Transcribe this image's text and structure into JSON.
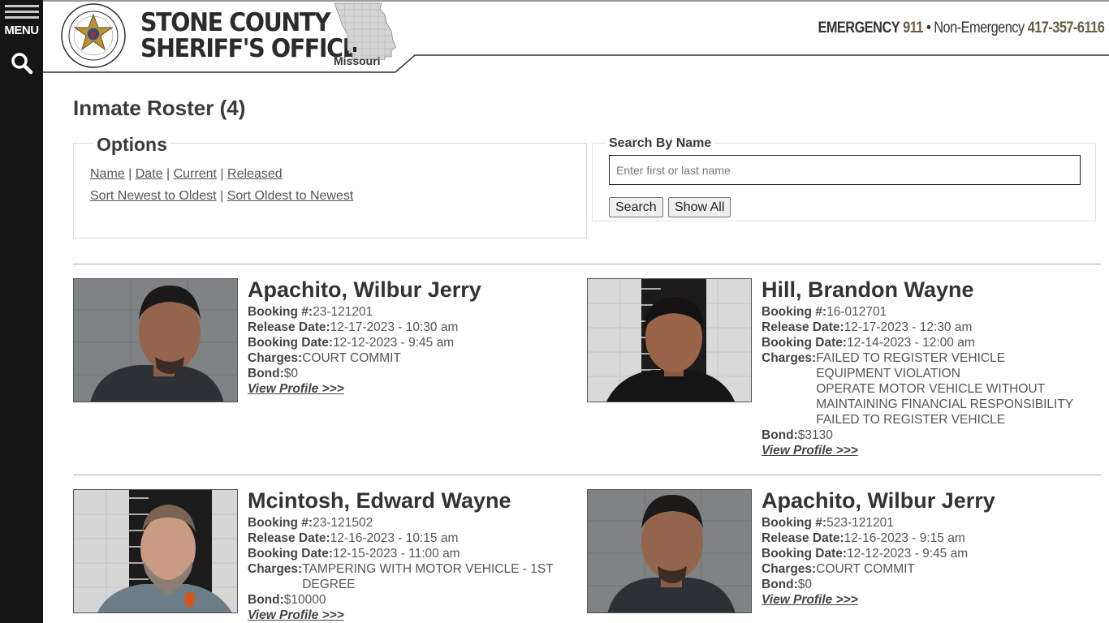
{
  "nav": {
    "menu_label": "MENU"
  },
  "header": {
    "org_line1": "STONE COUNTY",
    "org_line2": "SHERIFF'S OFFICE",
    "state_label": "Missouri",
    "seal_text_top": "STONE COUNTY SHERIFF'S OFFICE",
    "seal_text_center": "SHERIFF",
    "seal_text_bottom": "EST. 1851",
    "emergency_label": "EMERGENCY",
    "emergency_number": "911",
    "separator": "•",
    "nonemergency_label": "Non-Emergency",
    "nonemergency_number": "417-357-6116"
  },
  "page": {
    "title": "Inmate Roster (4)"
  },
  "options": {
    "legend": "Options",
    "sort_links": [
      "Name",
      "Date",
      "Current",
      "Released"
    ],
    "order_links": [
      "Sort Newest to Oldest",
      "Sort Oldest to Newest"
    ],
    "separator": "|"
  },
  "search": {
    "legend": "Search By Name",
    "placeholder": "Enter first or last name",
    "value": "",
    "search_button": "Search",
    "show_all_button": "Show All"
  },
  "labels": {
    "booking_no": "Booking #:",
    "release_date": "Release Date:",
    "booking_date": "Booking Date:",
    "charges": "Charges:",
    "bond": "Bond:",
    "view_profile": "View Profile >>>"
  },
  "inmates": [
    {
      "name": "Apachito, Wilbur Jerry",
      "booking_no": "23-121201",
      "release_date": "12-17-2023 - 10:30 am",
      "booking_date": "12-12-2023 - 9:45 am",
      "charges": [
        "COURT COMMIT"
      ],
      "bond": "$0"
    },
    {
      "name": "Hill, Brandon Wayne",
      "booking_no": "16-012701",
      "release_date": "12-17-2023 - 12:30 am",
      "booking_date": "12-14-2023 - 12:00 am",
      "charges": [
        "FAILED TO REGISTER VEHICLE",
        "EQUIPMENT VIOLATION",
        "OPERATE MOTOR VEHICLE WITHOUT",
        "MAINTAINING FINANCIAL RESPONSIBILITY",
        "FAILED TO REGISTER VEHICLE"
      ],
      "bond": "$3130"
    },
    {
      "name": "Mcintosh, Edward Wayne",
      "booking_no": "23-121502",
      "release_date": "12-16-2023 - 10:15 am",
      "booking_date": "12-15-2023 - 11:00 am",
      "charges": [
        "TAMPERING WITH MOTOR VEHICLE - 1ST",
        "DEGREE"
      ],
      "bond": "$10000"
    },
    {
      "name": "Apachito, Wilbur Jerry",
      "booking_no": "523-121201",
      "release_date": "12-16-2023 - 9:15 am",
      "booking_date": "12-12-2023 - 9:45 am",
      "charges": [
        "COURT COMMIT"
      ],
      "bond": "$0"
    }
  ],
  "colors": {
    "rail": "#151515",
    "accent_brown": "#6b5a43",
    "text": "#333333"
  }
}
